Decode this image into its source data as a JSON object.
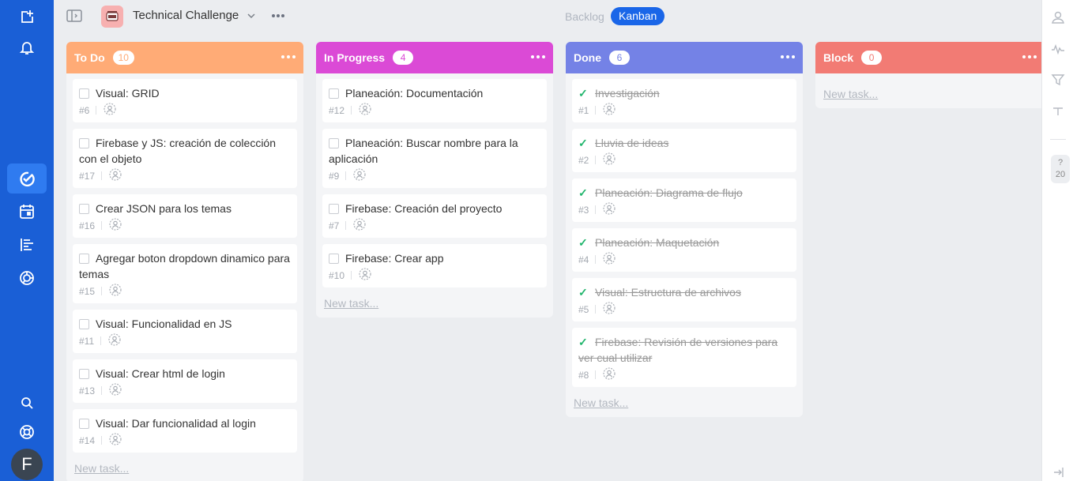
{
  "project": {
    "title": "Technical Challenge"
  },
  "views": {
    "backlog": "Backlog",
    "kanban": "Kanban"
  },
  "right": {
    "help": "?",
    "count": "20"
  },
  "avatar": {
    "initial": "F"
  },
  "new_task_label": "New task...",
  "columns": [
    {
      "title": "To Do",
      "count": "10",
      "color": "#ffab76",
      "tasks": [
        {
          "title": "Visual: GRID",
          "id": "#6"
        },
        {
          "title": "Firebase y JS: creación de colección con el objeto",
          "id": "#17"
        },
        {
          "title": "Crear JSON para los temas",
          "id": "#16"
        },
        {
          "title": "Agregar boton dropdown dinamico para temas",
          "id": "#15"
        },
        {
          "title": "Visual: Funcionalidad en JS",
          "id": "#11"
        },
        {
          "title": "Visual: Crear html de login",
          "id": "#13"
        },
        {
          "title": "Visual: Dar funcionalidad al login",
          "id": "#14"
        }
      ]
    },
    {
      "title": "In Progress",
      "count": "4",
      "color": "#db4ad6",
      "tasks": [
        {
          "title": "Planeación: Documentación",
          "id": "#12"
        },
        {
          "title": "Planeación: Buscar nombre para la aplicación",
          "id": "#9"
        },
        {
          "title": "Firebase: Creación del proyecto",
          "id": "#7"
        },
        {
          "title": "Firebase: Crear app",
          "id": "#10"
        }
      ]
    },
    {
      "title": "Done",
      "count": "6",
      "color": "#7482e6",
      "tasks": [
        {
          "title": "Investigación",
          "id": "#1"
        },
        {
          "title": "Lluvia de ideas",
          "id": "#2"
        },
        {
          "title": "Planeación: Diagrama de flujo",
          "id": "#3"
        },
        {
          "title": "Planeación: Maquetación",
          "id": "#4"
        },
        {
          "title": "Visual: Estructura de archivos",
          "id": "#5"
        },
        {
          "title": "Firebase: Revisión de versiones para ver cual utilizar",
          "id": "#8"
        }
      ]
    },
    {
      "title": "Block",
      "count": "0",
      "color": "#f27b74",
      "tasks": []
    }
  ]
}
